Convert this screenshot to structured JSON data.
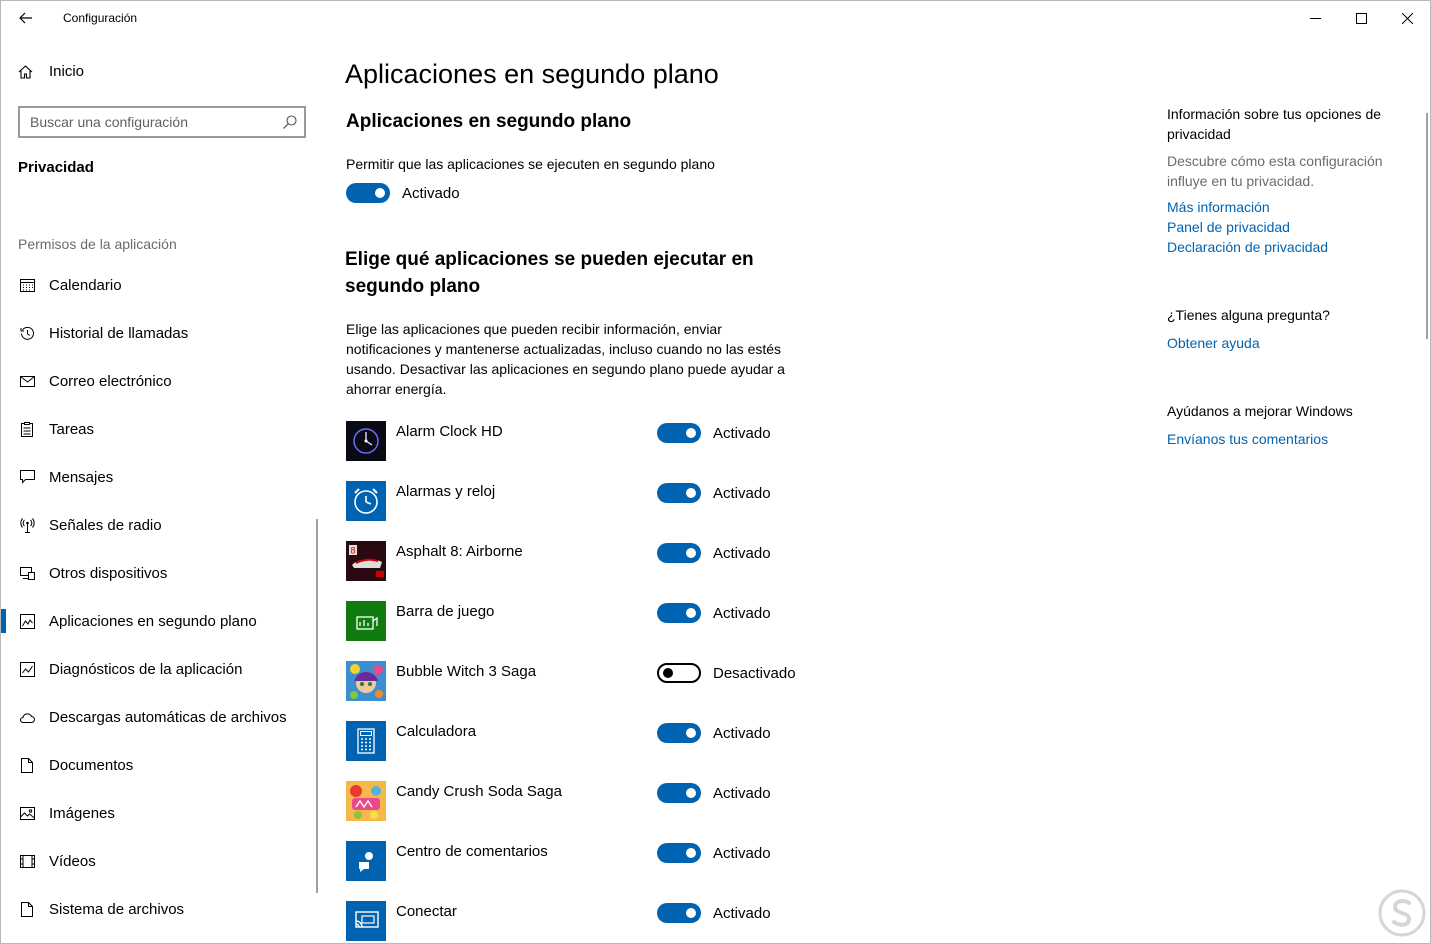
{
  "window": {
    "title": "Configuración"
  },
  "sidebar": {
    "home_label": "Inicio",
    "search_placeholder": "Buscar una configuración",
    "section": "Privacidad",
    "group": "Permisos de la aplicación",
    "items": [
      {
        "label": "Calendario",
        "icon": "calendar-icon"
      },
      {
        "label": "Historial de llamadas",
        "icon": "history-icon"
      },
      {
        "label": "Correo electrónico",
        "icon": "mail-icon"
      },
      {
        "label": "Tareas",
        "icon": "tasks-icon"
      },
      {
        "label": "Mensajes",
        "icon": "message-icon"
      },
      {
        "label": "Señales de radio",
        "icon": "radio-icon"
      },
      {
        "label": "Otros dispositivos",
        "icon": "devices-icon"
      },
      {
        "label": "Aplicaciones en segundo plano",
        "icon": "background-apps-icon",
        "selected": true
      },
      {
        "label": "Diagnósticos de la aplicación",
        "icon": "diagnostics-icon"
      },
      {
        "label": "Descargas automáticas de archivos",
        "icon": "cloud-icon"
      },
      {
        "label": "Documentos",
        "icon": "document-icon"
      },
      {
        "label": "Imágenes",
        "icon": "image-icon"
      },
      {
        "label": "Vídeos",
        "icon": "video-icon"
      },
      {
        "label": "Sistema de archivos",
        "icon": "file-system-icon"
      }
    ]
  },
  "main": {
    "title": "Aplicaciones en segundo plano",
    "subtitle": "Aplicaciones en segundo plano",
    "permit_text": "Permitir que las aplicaciones se ejecuten en segundo plano",
    "master_toggle": {
      "state": "on",
      "label": "Activado"
    },
    "choose_title": "Elige qué aplicaciones se pueden ejecutar en segundo plano",
    "choose_desc": "Elige las aplicaciones que pueden recibir información, enviar notificaciones y mantenerse actualizadas, incluso cuando no las estés usando. Desactivar las aplicaciones en segundo plano puede ayudar a ahorrar energía.",
    "apps": [
      {
        "name": "Alarm Clock HD",
        "state": "on",
        "label": "Activado",
        "icon": "alarm-clock-hd-icon"
      },
      {
        "name": "Alarmas y reloj",
        "state": "on",
        "label": "Activado",
        "icon": "alarms-clock-icon"
      },
      {
        "name": "Asphalt 8: Airborne",
        "state": "on",
        "label": "Activado",
        "icon": "asphalt-icon"
      },
      {
        "name": "Barra de juego",
        "state": "on",
        "label": "Activado",
        "icon": "game-bar-icon"
      },
      {
        "name": "Bubble Witch 3 Saga",
        "state": "off",
        "label": "Desactivado",
        "icon": "bubble-witch-icon"
      },
      {
        "name": "Calculadora",
        "state": "on",
        "label": "Activado",
        "icon": "calculator-icon"
      },
      {
        "name": "Candy Crush Soda Saga",
        "state": "on",
        "label": "Activado",
        "icon": "candy-crush-icon"
      },
      {
        "name": "Centro de comentarios",
        "state": "on",
        "label": "Activado",
        "icon": "feedback-hub-icon"
      },
      {
        "name": "Conectar",
        "state": "on",
        "label": "Activado",
        "icon": "connect-icon"
      }
    ]
  },
  "right": {
    "info_title": "Información sobre tus opciones de privacidad",
    "info_desc": "Descubre cómo esta configuración influye en tu privacidad.",
    "links": [
      "Más información",
      "Panel de privacidad",
      "Declaración de privacidad"
    ],
    "question": "¿Tienes alguna pregunta?",
    "help_link": "Obtener ayuda",
    "improve": "Ayúdanos a mejorar Windows",
    "feedback_link": "Envíanos tus comentarios"
  },
  "colors": {
    "accent": "#0063b1",
    "secondary_text": "#6b6b6b"
  }
}
